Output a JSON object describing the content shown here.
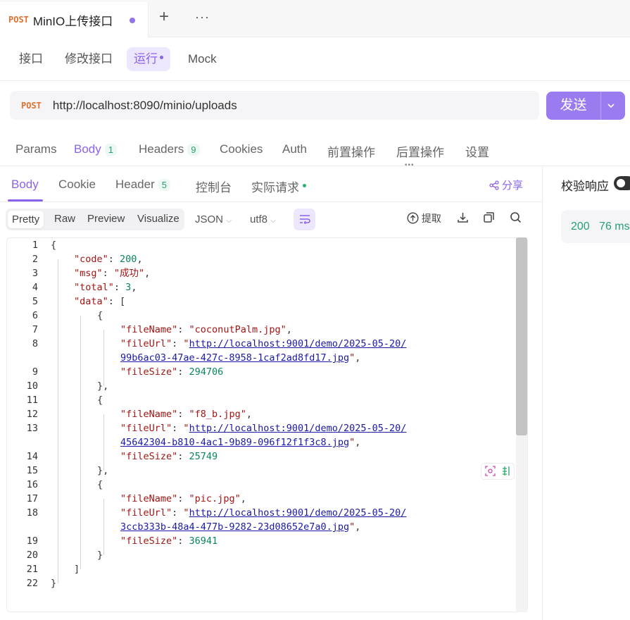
{
  "tab": {
    "method": "POST",
    "title": "MinIO上传接口",
    "plus": "+",
    "more": "···"
  },
  "modes": [
    "接口",
    "修改接口",
    "运行",
    "Mock"
  ],
  "request": {
    "method": "POST",
    "url": "http://localhost:8090/minio/uploads",
    "send_label": "发送"
  },
  "req_tabs": {
    "params": "Params",
    "body": "Body",
    "body_count": "1",
    "headers": "Headers",
    "headers_count": "9",
    "cookies": "Cookies",
    "auth": "Auth",
    "pre": "前置操作",
    "post": "后置操作",
    "settings": "设置"
  },
  "resp_tabs": {
    "body": "Body",
    "cookie": "Cookie",
    "header": "Header",
    "header_count": "5",
    "console": "控制台",
    "actual": "实际请求",
    "share": "分享"
  },
  "toolbar": {
    "pretty": "Pretty",
    "raw": "Raw",
    "preview": "Preview",
    "visualize": "Visualize",
    "format": "JSON",
    "encoding": "utf8",
    "extract": "提取"
  },
  "code": {
    "line_numbers": [
      "1",
      "2",
      "3",
      "4",
      "5",
      "6",
      "7",
      "8",
      "9",
      "10",
      "11",
      "12",
      "13",
      "14",
      "15",
      "16",
      "17",
      "18",
      "19",
      "20",
      "21",
      "22"
    ],
    "code_key": "\"code\"",
    "code_val": "200",
    "msg_key": "\"msg\"",
    "msg_val": "\"成功\"",
    "total_key": "\"total\"",
    "total_val": "3",
    "data_key": "\"data\"",
    "file_name_key": "\"fileName\"",
    "file_url_key": "\"fileUrl\"",
    "file_size_key": "\"fileSize\"",
    "items": [
      {
        "fileName": "\"coconutPalm.jpg\"",
        "url1": "http://localhost:9001/demo/2025-05-20/",
        "url2": "99b6ac03-47ae-427c-8958-1caf2ad8fd17.jpg",
        "fileSize": "294706"
      },
      {
        "fileName": "\"f8_b.jpg\"",
        "url1": "http://localhost:9001/demo/2025-05-20/",
        "url2": "45642304-b810-4ac1-9b89-096f12f1f3c8.jpg",
        "fileSize": "25749"
      },
      {
        "fileName": "\"pic.jpg\"",
        "url1": "http://localhost:9001/demo/2025-05-20/",
        "url2": "3ccb333b-48a4-477b-9282-23d08652e7a0.jpg",
        "fileSize": "36941"
      }
    ]
  },
  "right": {
    "title": "校验响应",
    "status": "200",
    "time": "76 ms"
  },
  "colors": {
    "accent": "#8a63ea",
    "post": "#e0702b",
    "success": "#27a070"
  }
}
